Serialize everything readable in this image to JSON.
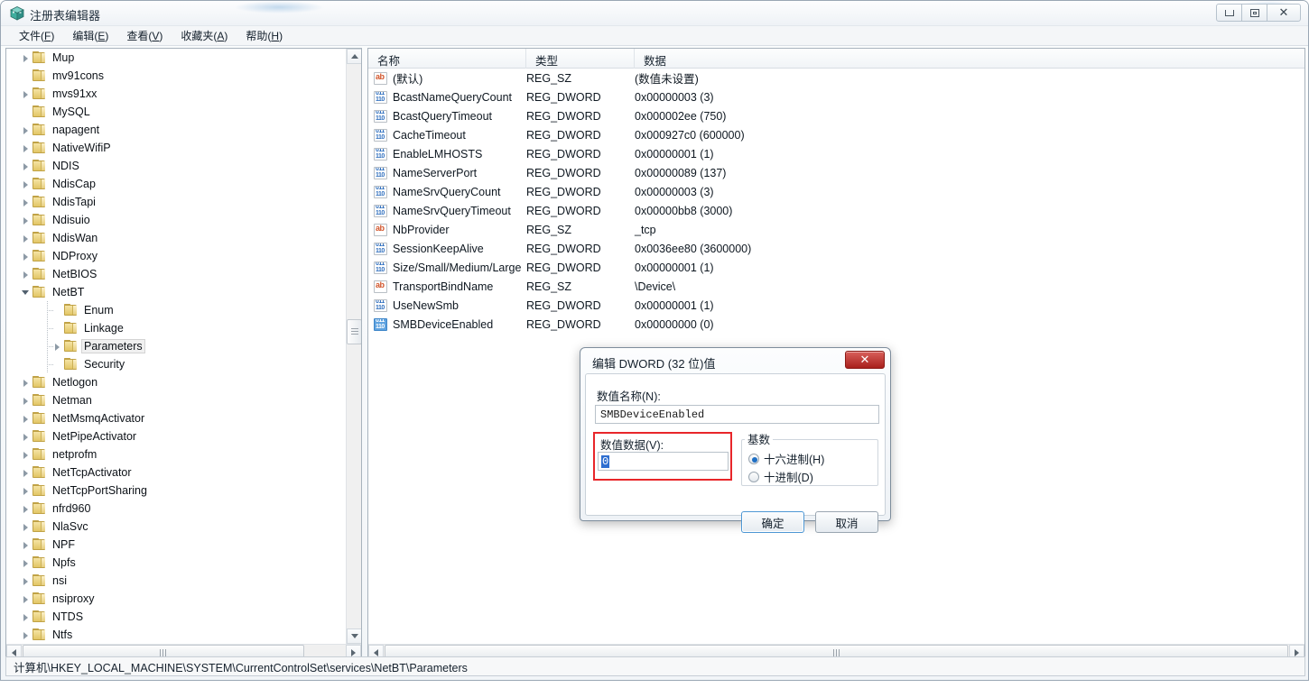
{
  "window": {
    "title": "注册表编辑器",
    "icon": "registry-icon",
    "controls": {
      "minimize": "最小化",
      "restore": "还原",
      "close": "关闭"
    }
  },
  "menubar": [
    {
      "label": "文件(F)",
      "name": "menu-file"
    },
    {
      "label": "编辑(E)",
      "name": "menu-edit"
    },
    {
      "label": "查看(V)",
      "name": "menu-view"
    },
    {
      "label": "收藏夹(A)",
      "name": "menu-favorites"
    },
    {
      "label": "帮助(H)",
      "name": "menu-help"
    }
  ],
  "tree": {
    "nodes": [
      {
        "label": "Mup",
        "indent": 0,
        "arrow": "collapsed",
        "selected": false
      },
      {
        "label": "mv91cons",
        "indent": 0,
        "arrow": "none",
        "selected": false
      },
      {
        "label": "mvs91xx",
        "indent": 0,
        "arrow": "collapsed",
        "selected": false
      },
      {
        "label": "MySQL",
        "indent": 0,
        "arrow": "none",
        "selected": false
      },
      {
        "label": "napagent",
        "indent": 0,
        "arrow": "collapsed",
        "selected": false
      },
      {
        "label": "NativeWifiP",
        "indent": 0,
        "arrow": "collapsed",
        "selected": false
      },
      {
        "label": "NDIS",
        "indent": 0,
        "arrow": "collapsed",
        "selected": false
      },
      {
        "label": "NdisCap",
        "indent": 0,
        "arrow": "collapsed",
        "selected": false
      },
      {
        "label": "NdisTapi",
        "indent": 0,
        "arrow": "collapsed",
        "selected": false
      },
      {
        "label": "Ndisuio",
        "indent": 0,
        "arrow": "collapsed",
        "selected": false
      },
      {
        "label": "NdisWan",
        "indent": 0,
        "arrow": "collapsed",
        "selected": false
      },
      {
        "label": "NDProxy",
        "indent": 0,
        "arrow": "collapsed",
        "selected": false
      },
      {
        "label": "NetBIOS",
        "indent": 0,
        "arrow": "collapsed",
        "selected": false
      },
      {
        "label": "NetBT",
        "indent": 0,
        "arrow": "expanded",
        "selected": false
      },
      {
        "label": "Enum",
        "indent": 1,
        "arrow": "none",
        "selected": false
      },
      {
        "label": "Linkage",
        "indent": 1,
        "arrow": "none",
        "selected": false
      },
      {
        "label": "Parameters",
        "indent": 1,
        "arrow": "collapsed",
        "selected": true
      },
      {
        "label": "Security",
        "indent": 1,
        "arrow": "none",
        "selected": false
      },
      {
        "label": "Netlogon",
        "indent": 0,
        "arrow": "collapsed",
        "selected": false
      },
      {
        "label": "Netman",
        "indent": 0,
        "arrow": "collapsed",
        "selected": false
      },
      {
        "label": "NetMsmqActivator",
        "indent": 0,
        "arrow": "collapsed",
        "selected": false
      },
      {
        "label": "NetPipeActivator",
        "indent": 0,
        "arrow": "collapsed",
        "selected": false
      },
      {
        "label": "netprofm",
        "indent": 0,
        "arrow": "collapsed",
        "selected": false
      },
      {
        "label": "NetTcpActivator",
        "indent": 0,
        "arrow": "collapsed",
        "selected": false
      },
      {
        "label": "NetTcpPortSharing",
        "indent": 0,
        "arrow": "collapsed",
        "selected": false
      },
      {
        "label": "nfrd960",
        "indent": 0,
        "arrow": "collapsed",
        "selected": false
      },
      {
        "label": "NlaSvc",
        "indent": 0,
        "arrow": "collapsed",
        "selected": false
      },
      {
        "label": "NPF",
        "indent": 0,
        "arrow": "collapsed",
        "selected": false
      },
      {
        "label": "Npfs",
        "indent": 0,
        "arrow": "collapsed",
        "selected": false
      },
      {
        "label": "nsi",
        "indent": 0,
        "arrow": "collapsed",
        "selected": false
      },
      {
        "label": "nsiproxy",
        "indent": 0,
        "arrow": "collapsed",
        "selected": false
      },
      {
        "label": "NTDS",
        "indent": 0,
        "arrow": "collapsed",
        "selected": false
      },
      {
        "label": "Ntfs",
        "indent": 0,
        "arrow": "collapsed",
        "selected": false
      }
    ]
  },
  "list": {
    "columns": [
      "名称",
      "类型",
      "数据"
    ],
    "rows": [
      {
        "icon": "string-value-icon",
        "kind": "sz",
        "name": "(默认)",
        "type": "REG_SZ",
        "data": "(数值未设置)",
        "selected": false
      },
      {
        "icon": "dword-value-icon",
        "kind": "dw",
        "name": "BcastNameQueryCount",
        "type": "REG_DWORD",
        "data": "0x00000003 (3)",
        "selected": false
      },
      {
        "icon": "dword-value-icon",
        "kind": "dw",
        "name": "BcastQueryTimeout",
        "type": "REG_DWORD",
        "data": "0x000002ee (750)",
        "selected": false
      },
      {
        "icon": "dword-value-icon",
        "kind": "dw",
        "name": "CacheTimeout",
        "type": "REG_DWORD",
        "data": "0x000927c0 (600000)",
        "selected": false
      },
      {
        "icon": "dword-value-icon",
        "kind": "dw",
        "name": "EnableLMHOSTS",
        "type": "REG_DWORD",
        "data": "0x00000001 (1)",
        "selected": false
      },
      {
        "icon": "dword-value-icon",
        "kind": "dw",
        "name": "NameServerPort",
        "type": "REG_DWORD",
        "data": "0x00000089 (137)",
        "selected": false
      },
      {
        "icon": "dword-value-icon",
        "kind": "dw",
        "name": "NameSrvQueryCount",
        "type": "REG_DWORD",
        "data": "0x00000003 (3)",
        "selected": false
      },
      {
        "icon": "dword-value-icon",
        "kind": "dw",
        "name": "NameSrvQueryTimeout",
        "type": "REG_DWORD",
        "data": "0x00000bb8 (3000)",
        "selected": false
      },
      {
        "icon": "string-value-icon",
        "kind": "sz",
        "name": "NbProvider",
        "type": "REG_SZ",
        "data": "_tcp",
        "selected": false
      },
      {
        "icon": "dword-value-icon",
        "kind": "dw",
        "name": "SessionKeepAlive",
        "type": "REG_DWORD",
        "data": "0x0036ee80 (3600000)",
        "selected": false
      },
      {
        "icon": "dword-value-icon",
        "kind": "dw",
        "name": "Size/Small/Medium/Large",
        "type": "REG_DWORD",
        "data": "0x00000001 (1)",
        "selected": false
      },
      {
        "icon": "string-value-icon",
        "kind": "sz",
        "name": "TransportBindName",
        "type": "REG_SZ",
        "data": "\\Device\\",
        "selected": false
      },
      {
        "icon": "dword-value-icon",
        "kind": "dw",
        "name": "UseNewSmb",
        "type": "REG_DWORD",
        "data": "0x00000001 (1)",
        "selected": false
      },
      {
        "icon": "dword-value-icon",
        "kind": "dw",
        "name": "SMBDeviceEnabled",
        "type": "REG_DWORD",
        "data": "0x00000000 (0)",
        "selected": true
      }
    ]
  },
  "statusbar": {
    "path": "计算机\\HKEY_LOCAL_MACHINE\\SYSTEM\\CurrentControlSet\\services\\NetBT\\Parameters"
  },
  "dialog": {
    "title": "编辑 DWORD (32 位)值",
    "close_label": "✕",
    "name_label": "数值名称(N):",
    "name_value": "SMBDeviceEnabled",
    "data_label": "数值数据(V):",
    "data_value": "0",
    "base_legend": "基数",
    "radio_hex": "十六进制(H)",
    "radio_dec": "十进制(D)",
    "ok_label": "确定",
    "cancel_label": "取消",
    "highlight_color": "#e8262a"
  }
}
